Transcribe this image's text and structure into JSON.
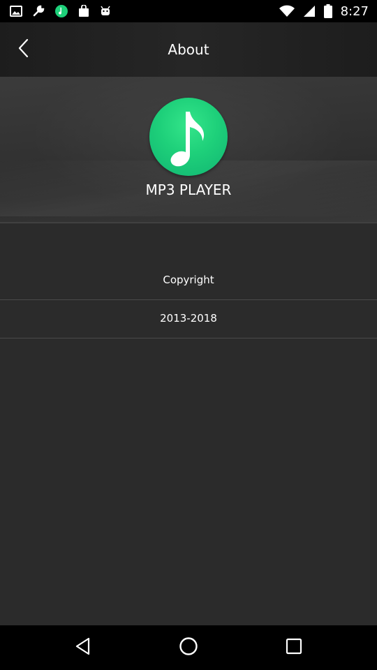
{
  "status_bar": {
    "time": "8:27",
    "left_icons": [
      "image-icon",
      "wrench-icon",
      "app-notification-icon",
      "bag-icon",
      "android-icon"
    ],
    "right_icons": [
      "wifi-icon",
      "cellular-icon",
      "battery-icon"
    ]
  },
  "header": {
    "title": "About",
    "back_icon": "chevron-left-icon"
  },
  "app": {
    "logo_icon": "music-note-icon",
    "logo_color": "#1ed07a",
    "name": "MP3 PLAYER"
  },
  "info": {
    "copyright_label": "Copyright",
    "years": "2013-2018"
  },
  "nav_bar": {
    "buttons": [
      "back-triangle-icon",
      "home-circle-icon",
      "recents-square-icon"
    ]
  }
}
